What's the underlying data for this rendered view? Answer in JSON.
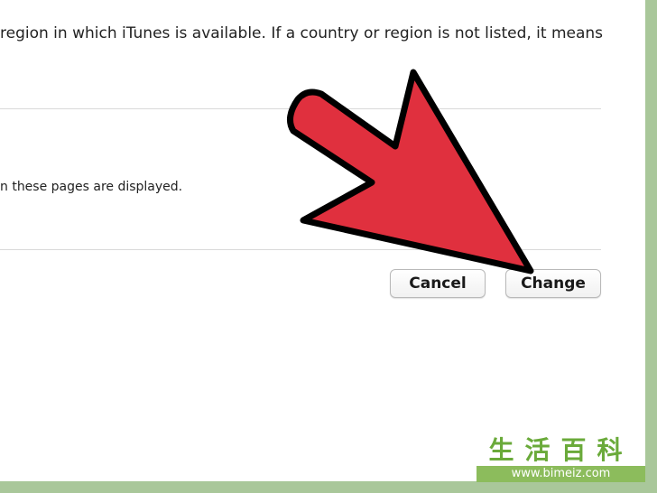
{
  "dialog": {
    "description_line": "region in which iTunes is available. If a country or region is not listed, it means",
    "pages_line": "n these pages are displayed."
  },
  "buttons": {
    "cancel_label": "Cancel",
    "change_label": "Change"
  },
  "annotation": {
    "arrow_color": "#e0303e",
    "arrow_outline": "#000000"
  },
  "watermark": {
    "chinese_text": "生活百科",
    "url": "www.bimeiz.com"
  }
}
